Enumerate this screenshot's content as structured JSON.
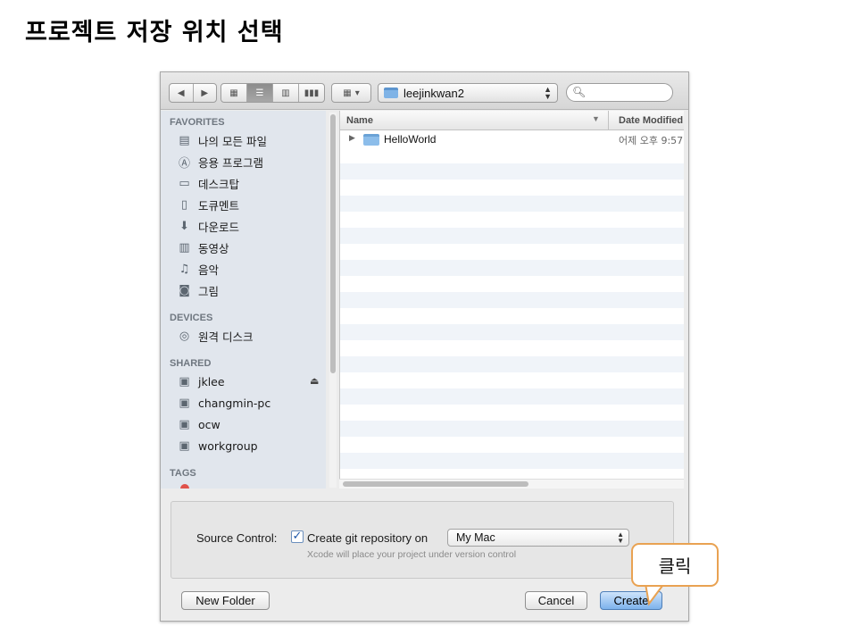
{
  "slide": {
    "title": "프로젝트 저장 위치 선택"
  },
  "toolbar": {
    "back_icon": "◀",
    "forward_icon": "▶",
    "view_icons": [
      "icon-view",
      "list-view",
      "column-view",
      "coverflow-view"
    ],
    "arrange_icon": "arrange-icon",
    "location": "leejinkwan2",
    "search_placeholder": ""
  },
  "sidebar": {
    "sections": {
      "favorites": "FAVORITES",
      "devices": "DEVICES",
      "shared": "SHARED",
      "tags": "TAGS"
    },
    "favorites": [
      "나의 모든 파일",
      "응용 프로그램",
      "데스크탑",
      "도큐멘트",
      "다운로드",
      "동영상",
      "음악",
      "그림"
    ],
    "devices": [
      "원격 디스크"
    ],
    "shared": [
      "jklee",
      "changmin-pc",
      "ocw",
      "workgroup"
    ]
  },
  "filelist": {
    "col_name": "Name",
    "col_date": "Date Modified",
    "rows": [
      {
        "name": "HelloWorld",
        "date": "어제 오후 9:57"
      }
    ]
  },
  "options": {
    "source_control_label": "Source Control:",
    "checkbox_label": "Create git repository on",
    "checkbox_checked": true,
    "repo_target": "My Mac",
    "hint": "Xcode will place your project under version control"
  },
  "buttons": {
    "new_folder": "New Folder",
    "cancel": "Cancel",
    "create": "Create"
  },
  "callout": {
    "text": "클릭"
  },
  "colors": {
    "callout_border": "#e9a252",
    "primary_button": "#7db2ec",
    "sidebar_bg": "#e1e6ed"
  }
}
